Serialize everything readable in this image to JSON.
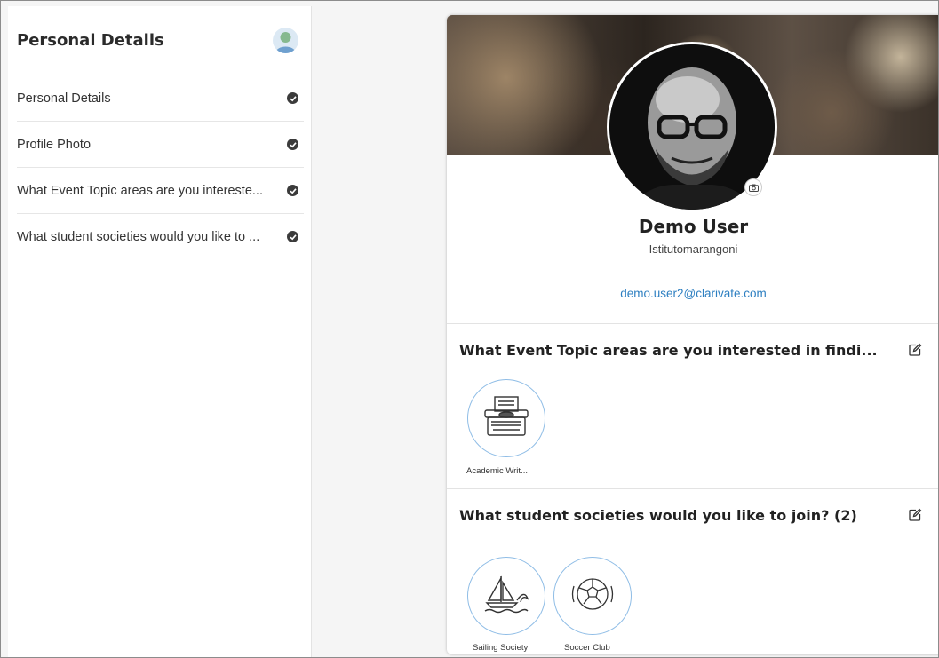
{
  "sidebar": {
    "title": "Personal Details",
    "items": [
      {
        "label": "Personal Details"
      },
      {
        "label": "Profile Photo"
      },
      {
        "label": "What Event Topic areas are you intereste..."
      },
      {
        "label": "What student societies would you like to ..."
      }
    ]
  },
  "profile": {
    "name": "Demo User",
    "organization": "Istitutomarangoni",
    "email": "demo.user2@clarivate.com"
  },
  "sections": [
    {
      "title": "What Event Topic areas are you interested in findi...",
      "items": [
        {
          "label": "Academic Writ...",
          "icon": "typewriter-icon"
        }
      ]
    },
    {
      "title": "What student societies would you like to join? (2)",
      "items": [
        {
          "label": "Sailing Society",
          "icon": "sailboat-icon"
        },
        {
          "label": "Soccer Club",
          "icon": "soccer-ball-icon"
        }
      ]
    }
  ],
  "colors": {
    "accent": "#2d7fc1",
    "bubble_border": "#8fbde6"
  }
}
